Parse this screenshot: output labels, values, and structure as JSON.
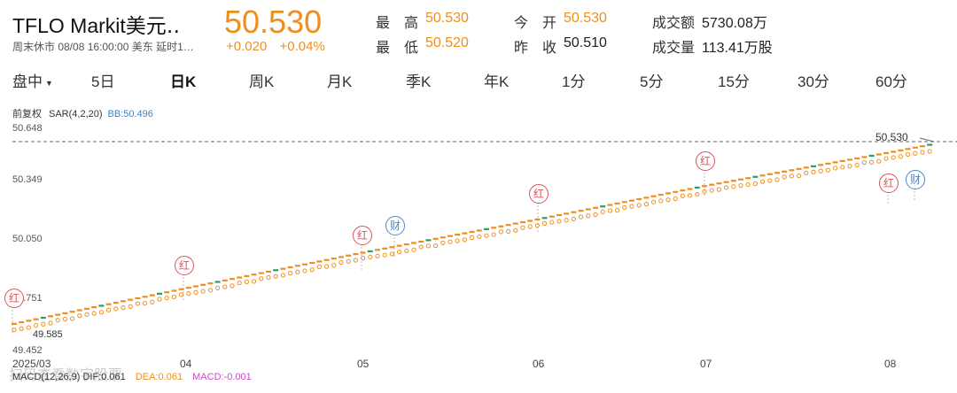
{
  "header": {
    "name": "TFLO Markit美元‥",
    "subtitle": "周末休市 08/08 16:00:00 美东 延时1…",
    "price": "50.530",
    "change": "+0.020",
    "change_pct": "+0.04%",
    "stats": {
      "high_label": "最　高",
      "high": "50.530",
      "low_label": "最　低",
      "low": "50.520",
      "open_label": "今　开",
      "open": "50.530",
      "prev_close_label": "昨　收",
      "prev_close": "50.510",
      "turnover_label": "成交额",
      "turnover": "5730.08万",
      "volume_label": "成交量",
      "volume": "113.41万股"
    }
  },
  "tabs": [
    {
      "label": "盘中",
      "active": false
    },
    {
      "label": "5日",
      "active": false
    },
    {
      "label": "日K",
      "active": true
    },
    {
      "label": "周K",
      "active": false
    },
    {
      "label": "月K",
      "active": false
    },
    {
      "label": "季K",
      "active": false
    },
    {
      "label": "年K",
      "active": false
    },
    {
      "label": "1分",
      "active": false
    },
    {
      "label": "5分",
      "active": false
    },
    {
      "label": "15分",
      "active": false
    },
    {
      "label": "30分",
      "active": false
    },
    {
      "label": "60分",
      "active": false
    }
  ],
  "indicator": {
    "type": "前复权",
    "sar": "SAR(4,2,20)",
    "bb": "BB:50.496"
  },
  "colors": {
    "accent": "#ef8e1c",
    "up_candle": "#ef8e1c",
    "down_candle": "#2a9d6a",
    "badge_red": "#d9535a",
    "badge_blue": "#4a88cc"
  },
  "badges": {
    "red": "红",
    "blue": "财"
  },
  "chart_data": {
    "type": "line",
    "y_ticks": [
      "50.648",
      "50.349",
      "50.050",
      "49.751",
      "49.452"
    ],
    "ylim": [
      49.452,
      50.648
    ],
    "x_ticks": [
      "2025/03",
      "04",
      "05",
      "06",
      "07",
      "08"
    ],
    "last_price_label": "50.530",
    "low_label": "49.585",
    "series": [
      {
        "x": [
          "2025/03",
          "04",
          "05",
          "06",
          "07",
          "08"
        ],
        "values": [
          49.585,
          49.78,
          49.97,
          50.15,
          50.33,
          50.51
        ]
      }
    ],
    "events": [
      {
        "kind": "红",
        "x": "2025/03"
      },
      {
        "kind": "红",
        "x": "04"
      },
      {
        "kind": "红",
        "x": "05"
      },
      {
        "kind": "财",
        "x": "05"
      },
      {
        "kind": "红",
        "x": "06"
      },
      {
        "kind": "红",
        "x": "07"
      },
      {
        "kind": "红",
        "x": "08"
      },
      {
        "kind": "财",
        "x": "08"
      }
    ]
  },
  "macd": {
    "label": "MACD(12,26,9)",
    "dif": "DIF:0.061",
    "dea": "DEA:0.061",
    "macd": "MACD:-0.001"
  },
  "watermark": "扫码查看数字股票"
}
